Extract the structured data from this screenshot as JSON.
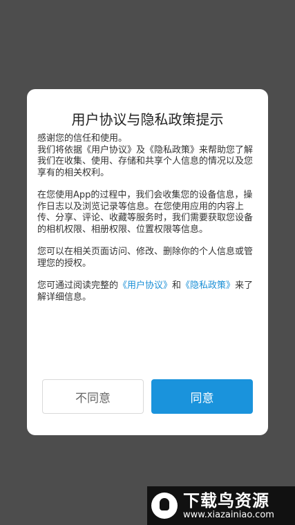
{
  "dialog": {
    "title": "用户协议与隐私政策提示",
    "paragraphs": {
      "p1": "感谢您的信任和使用。",
      "p2_pre": "我们将依据《用户协议》及《隐私政策》来帮助您了解我们在收集、使用、存储和共享个人信息的情况以及您享有的相关权利。",
      "p3": "在您使用App的过程中，我们会收集您的设备信息，操作日志以及浏览记录等信息。在您使用应用的内容上传、分享、评论、收藏等服务时，我们需要获取您设备的相机权限、相册权限、位置权限等信息。",
      "p4": "您可以在相关页面访问、修改、删除你的个人信息或管理您的授权。",
      "p5_pre": "您可通过阅读完整的",
      "p5_link1": "《用户协议》",
      "p5_mid": "和",
      "p5_link2": "《隐私政策》",
      "p5_post": "来了解详细信息。"
    },
    "buttons": {
      "disagree": "不同意",
      "agree": "同意"
    }
  },
  "watermark": {
    "name": "下载鸟资源",
    "url": "www.xiazainiao.com"
  },
  "colors": {
    "accent": "#1a93dc",
    "overlay": "#4d4d4d"
  }
}
